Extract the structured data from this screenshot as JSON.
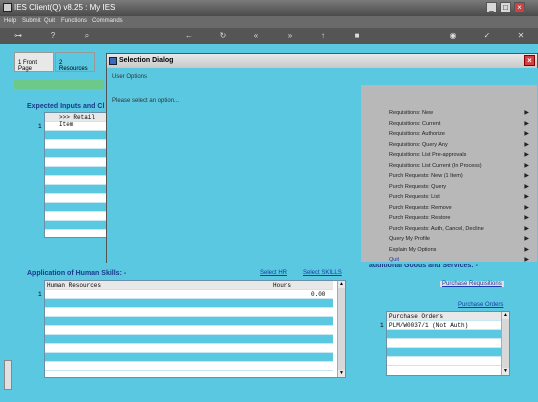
{
  "window": {
    "title": "IES Client(Q) v8.25 : My IES",
    "min": "_",
    "max": "□",
    "close": "×"
  },
  "menu": [
    "Help",
    "Submit",
    "Quit",
    "Functions",
    "Commands"
  ],
  "tabs": [
    {
      "label": "1 Front Page"
    },
    {
      "label": "2 Resources"
    }
  ],
  "section_expected": {
    "title": "Expected Inputs and Cl",
    "col_header": ">>> Retail Item",
    "row_index": "1"
  },
  "section_human": {
    "title": "Application of Human Skills: -",
    "select_hr": "Select HR",
    "select_skills": "Select SKILLS",
    "col_resources": "Human Resources",
    "col_hours": "Hours",
    "row_index": "1",
    "row_hours": "0.00"
  },
  "section_additional": {
    "title": "additional Goods and Services: -",
    "purchase_requisitions": "Purchase Requisitions",
    "purchase_orders_link": "Purchase Orders",
    "col_header": "Purchase Orders",
    "row_index": "1",
    "row_value": "PLM/W0037/1 (Not Auth)"
  },
  "dialog": {
    "title": "Selection Dialog",
    "close": "×",
    "subheader": "User Options",
    "prompt": "Please select an option...",
    "items": [
      {
        "label": "Requisitions: New"
      },
      {
        "label": "Requisitions: Current"
      },
      {
        "label": "Requisitions: Authorize"
      },
      {
        "label": "Requisitions: Query Any"
      },
      {
        "label": "Requisitions: List Pre-approvals"
      },
      {
        "label": "Requisitions: List Current (In Process)"
      },
      {
        "label": "Purch Requests: New (1 Item)"
      },
      {
        "label": "Purch Requests: Query"
      },
      {
        "label": "Purch Requests: List"
      },
      {
        "label": "Purch Requests: Remove"
      },
      {
        "label": "Purch Requests: Restore"
      },
      {
        "label": "Purch Requests: Auth, Cancel, Decline"
      },
      {
        "label": "Query My Profile"
      },
      {
        "label": "Explain My Options"
      },
      {
        "label": "Quit"
      }
    ],
    "arrow": "▶"
  },
  "scroll": {
    "up": "▲",
    "down": "▼"
  },
  "colors": {
    "accent": "#5ac8e0",
    "dialog_right": "#b8b8b8",
    "link": "#1a3aa8",
    "section_title": "#1a3a8a"
  }
}
